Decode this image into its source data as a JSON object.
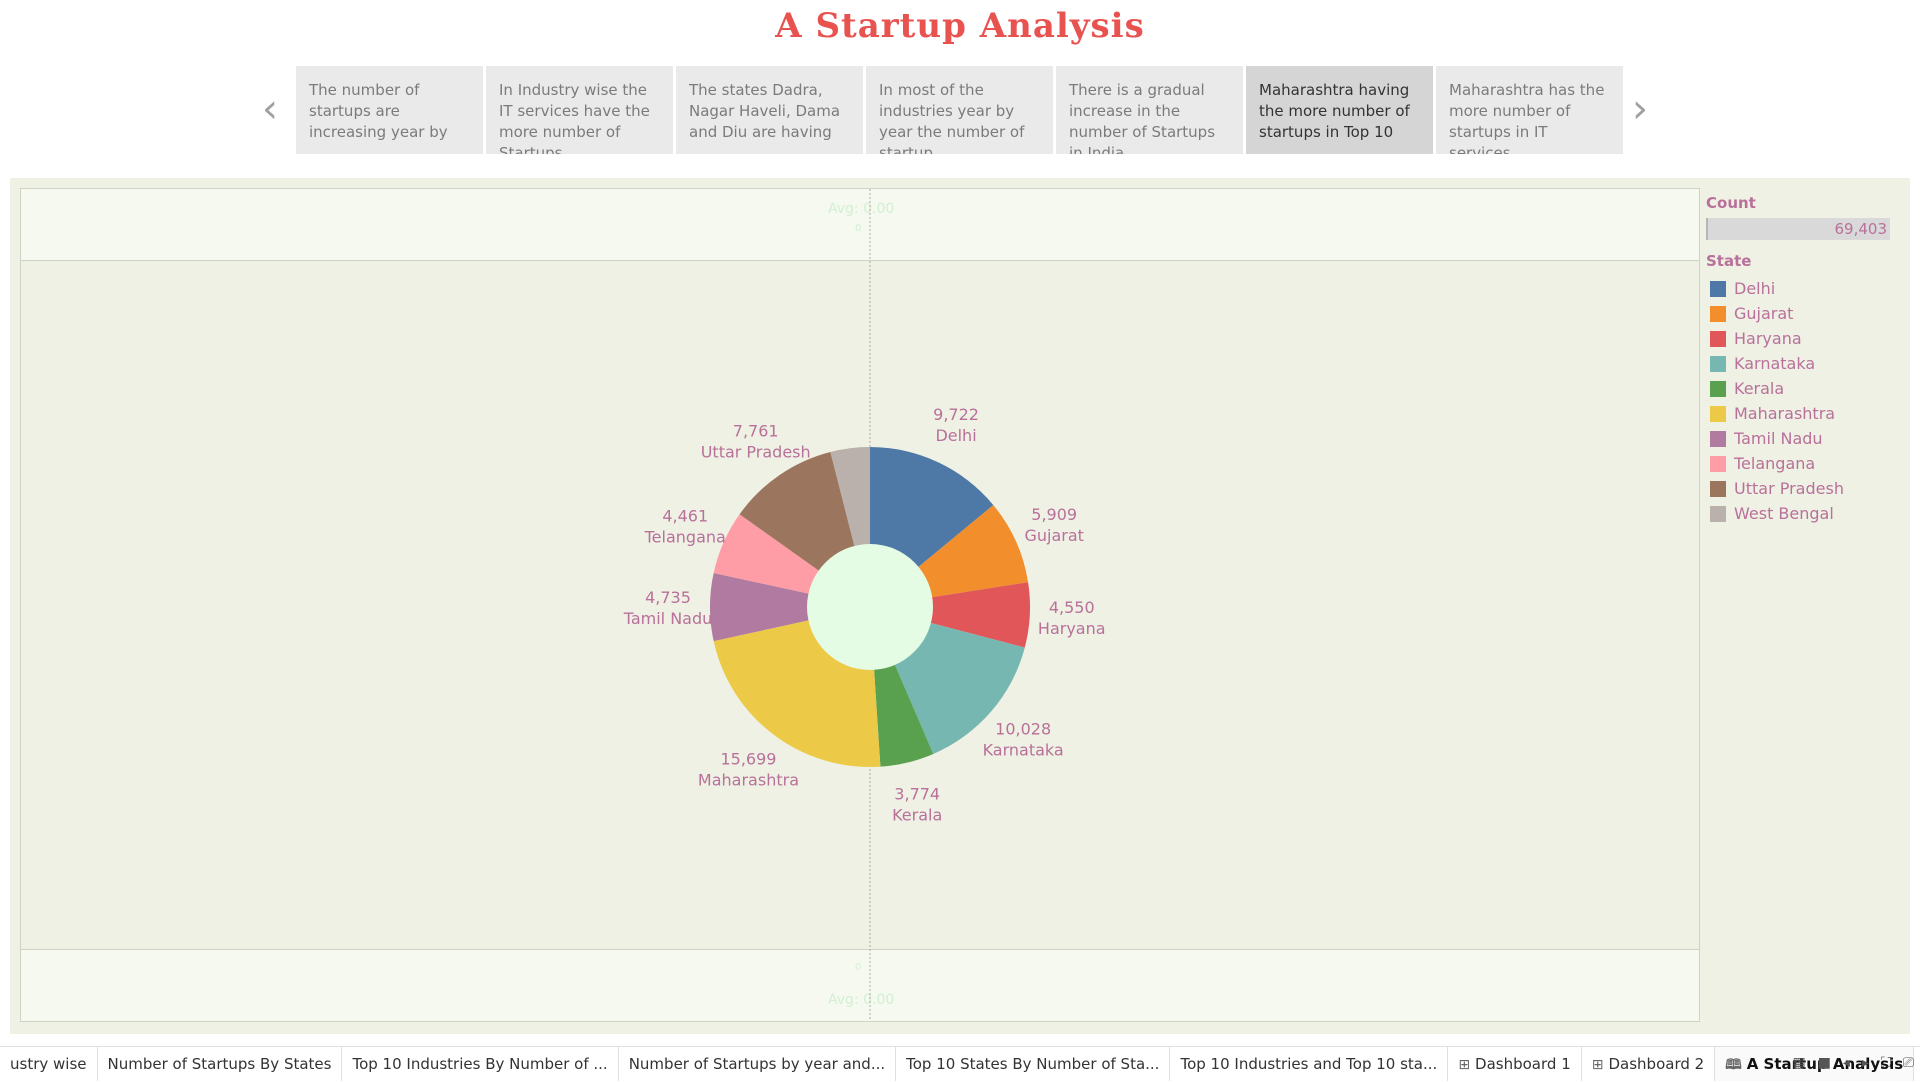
{
  "title": "A Startup Analysis",
  "story_points": [
    "The number of startups are increasing year by",
    "In Industry wise the IT services have the more number of Startups",
    "The states Dadra, Nagar Haveli, Dama and Diu are having",
    "In most of the industries year by year the number of startup",
    "There is a gradual increase in the number of Startups in India",
    "Maharashtra having the more number of startups in Top 10",
    "Maharashtra has the more number of startups in IT services"
  ],
  "active_story_index": 5,
  "ghost_labels": {
    "top": "Avg: 0.00",
    "top_sub": "0",
    "bottom": "0",
    "bottom_sub": "Avg: 0.00"
  },
  "legend": {
    "count_title": "Count",
    "count_value": "69,403",
    "state_title": "State",
    "items": [
      {
        "label": "Delhi",
        "color": "#4e79a7"
      },
      {
        "label": "Gujarat",
        "color": "#f28e2b"
      },
      {
        "label": "Haryana",
        "color": "#e15759"
      },
      {
        "label": "Karnataka",
        "color": "#76b7b2"
      },
      {
        "label": "Kerala",
        "color": "#59a14f"
      },
      {
        "label": "Maharashtra",
        "color": "#edc948"
      },
      {
        "label": "Tamil Nadu",
        "color": "#b07aa1"
      },
      {
        "label": "Telangana",
        "color": "#ff9da7"
      },
      {
        "label": "Uttar Pradesh",
        "color": "#9c755f"
      },
      {
        "label": "West Bengal",
        "color": "#bab0ac"
      }
    ]
  },
  "chart_data": {
    "type": "pie",
    "title": "",
    "categories": [
      "Delhi",
      "Gujarat",
      "Haryana",
      "Karnataka",
      "Kerala",
      "Maharashtra",
      "Tamil Nadu",
      "Telangana",
      "Uttar Pradesh",
      "West Bengal"
    ],
    "values": [
      9722,
      5909,
      4550,
      10028,
      3774,
      15699,
      4735,
      4461,
      7761,
      2764
    ],
    "value_labels": [
      "9,722",
      "5,909",
      "4,550",
      "10,028",
      "3,774",
      "15,699",
      "4,735",
      "4,461",
      "7,761",
      ""
    ],
    "colors": [
      "#4e79a7",
      "#f28e2b",
      "#e15759",
      "#76b7b2",
      "#59a14f",
      "#edc948",
      "#b07aa1",
      "#ff9da7",
      "#9c755f",
      "#bab0ac"
    ],
    "donut": true,
    "hole_color": "#e4fbe4",
    "label_color": "#b9709a",
    "legend": "right"
  },
  "tabs": [
    {
      "label": "ustry wise",
      "icon": "",
      "active": false
    },
    {
      "label": "Number of Startups By States",
      "icon": "",
      "active": false
    },
    {
      "label": "Top 10 Industries By Number of ...",
      "icon": "",
      "active": false
    },
    {
      "label": "Number of Startups by year and...",
      "icon": "",
      "active": false
    },
    {
      "label": "Top 10 States By Number of Sta...",
      "icon": "",
      "active": false
    },
    {
      "label": "Top 10 Industries and Top 10 sta...",
      "icon": "",
      "active": false
    },
    {
      "label": "Dashboard 1",
      "icon": "⊞",
      "active": false
    },
    {
      "label": "Dashboard 2",
      "icon": "⊞",
      "active": false
    },
    {
      "label": "A Startup Analysis",
      "icon": "🕮",
      "active": true
    }
  ]
}
